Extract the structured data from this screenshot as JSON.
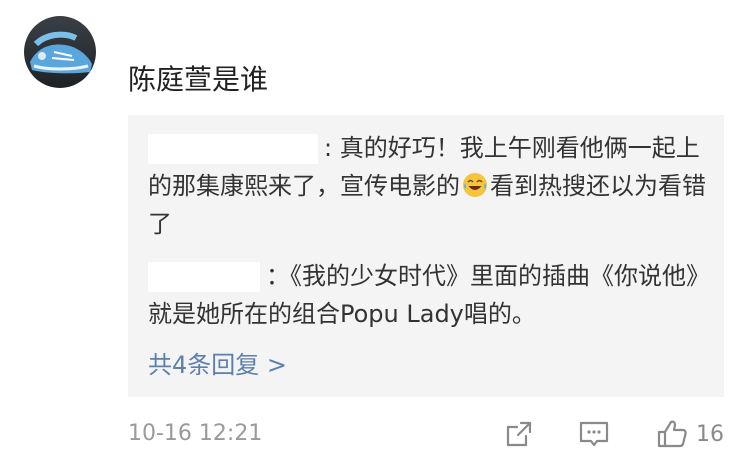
{
  "comment": {
    "avatar_icon": "sneaker-photo-avatar",
    "text": "陈庭萱是谁",
    "timestamp": "10-16 12:21",
    "like_count": "16"
  },
  "replies": [
    {
      "text_before_emoji": ": 真的好巧！我上午刚看他俩一起上的那集康熙来了，宣传电影的",
      "emoji": "laughing-tears-emoji",
      "text_after_emoji": "看到热搜还以为看错了"
    },
    {
      "text": "：《我的少女时代》里面的插曲《你说他》就是她所在的组合Popu Lady唱的。"
    }
  ],
  "more_replies_label": "共4条回复 >",
  "colors": {
    "link": "#5b7fb0",
    "reply_bg": "#f4f4f4",
    "meta": "#9a9a9a"
  }
}
